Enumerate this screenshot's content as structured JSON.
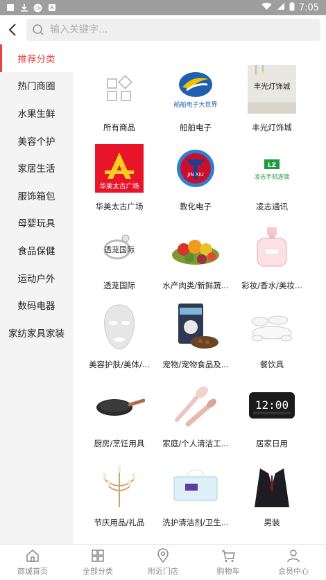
{
  "status_bar": {
    "time": "7:05"
  },
  "search": {
    "placeholder": "输入关键字..."
  },
  "sidebar": {
    "items": [
      {
        "label": "推荐分类",
        "active": true
      },
      {
        "label": "热门商圈"
      },
      {
        "label": "水果生鲜"
      },
      {
        "label": "美容个护"
      },
      {
        "label": "家居生活"
      },
      {
        "label": "服饰箱包"
      },
      {
        "label": "母婴玩具"
      },
      {
        "label": "食品保健"
      },
      {
        "label": "运动户外"
      },
      {
        "label": "数码电器"
      },
      {
        "label": "家纺家具家装"
      }
    ]
  },
  "categories": [
    {
      "label": "所有商品",
      "icon": "grid-icon"
    },
    {
      "label": "船舶电子",
      "logo_text": "船舶电子大世界"
    },
    {
      "label": "丰光灯饰城",
      "logo_text": "丰光灯饰城"
    },
    {
      "label": "华美太古广场",
      "logo_text": "华美太古广场"
    },
    {
      "label": "教化电子",
      "logo_text": "JIN XIU"
    },
    {
      "label": "凌志通讯",
      "logo_text": "凌志手机连锁"
    },
    {
      "label": "透茏国际",
      "logo_text": "透茏国际"
    },
    {
      "label": "水产肉类/新鲜蔬...",
      "icon": "vegetables-image"
    },
    {
      "label": "彩妆/香水/美妆...",
      "icon": "perfume-image"
    },
    {
      "label": "美容护肤/美体/...",
      "icon": "face-mask-image"
    },
    {
      "label": "宠物/宠物食品及...",
      "icon": "pet-food-image"
    },
    {
      "label": "餐饮具",
      "icon": "tableware-image"
    },
    {
      "label": "厨房/烹饪用具",
      "icon": "frying-pan-image"
    },
    {
      "label": "家庭/个人清洁工...",
      "icon": "cleaning-brush-image"
    },
    {
      "label": "居家日用",
      "icon": "digital-clock-image"
    },
    {
      "label": "节庆用品/礼品",
      "icon": "candelabra-image"
    },
    {
      "label": "洗护清洁剂/卫生...",
      "icon": "tissue-box-image"
    },
    {
      "label": "男装",
      "icon": "suit-image"
    }
  ],
  "clock_display": "12:00",
  "tabs": [
    {
      "label": "商城首页",
      "icon": "home-icon"
    },
    {
      "label": "全部分类",
      "icon": "grid-icon"
    },
    {
      "label": "附近门店",
      "icon": "location-icon"
    },
    {
      "label": "购物车",
      "icon": "cart-icon"
    },
    {
      "label": "会员中心",
      "icon": "user-icon"
    }
  ],
  "colors": {
    "accent": "#e84444",
    "status_bar": "#9e9e9e",
    "sidebar_bg": "#f4f4f4",
    "icon_gray": "#888888"
  }
}
